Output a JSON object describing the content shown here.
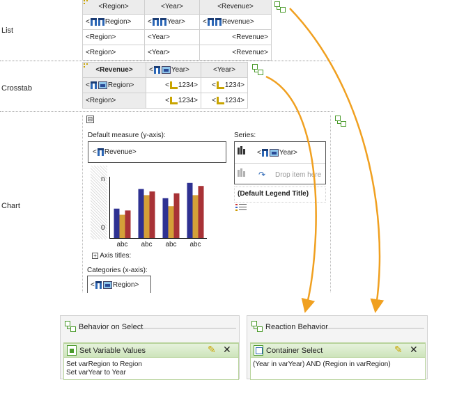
{
  "rows": {
    "list": "List",
    "crosstab": "Crosstab",
    "chart": "Chart"
  },
  "list": {
    "headers": [
      "<Region>",
      "<Year>",
      "<Revenue>"
    ],
    "field_row": {
      "region_pre": "<",
      "region": "Region>",
      "year_pre": "<",
      "year": "Year>",
      "revenue_pre": "<",
      "revenue": "Revenue>"
    },
    "rows": [
      [
        "<Region>",
        "<Year>",
        "<Revenue>"
      ],
      [
        "<Region>",
        "<Year>",
        "<Revenue>"
      ]
    ]
  },
  "crosstab": {
    "corner": "<Revenue>",
    "col_year_field_pre": "<",
    "col_year_field": "Year>",
    "col_year": "<Year>",
    "row1_pre": "<",
    "row1": "Region>",
    "row2": "<Region>",
    "cell_pre": "<",
    "cell": "1234>"
  },
  "chart": {
    "collapse_icon": "⊟",
    "default_measure_label": "Default measure (y-axis):",
    "measure_pre": "<",
    "measure": "Revenue>",
    "series_label": "Series:",
    "series_pre": "<",
    "series_field": "Year>",
    "drop_item": "Drop item here",
    "legend_title": "(Default Legend Title)",
    "y_top": "n",
    "y_bottom": "0",
    "axis_titles": "Axis titles:",
    "categories_label": "Categories (x-axis):",
    "categories_pre": "<",
    "categories_field": "Region>"
  },
  "chart_data": {
    "type": "bar",
    "categories": [
      "abc",
      "abc",
      "abc",
      "abc"
    ],
    "series": [
      {
        "values": [
          0.48,
          0.8,
          0.65,
          0.9
        ],
        "color": "#2e3192"
      },
      {
        "values": [
          0.38,
          0.7,
          0.52,
          0.7
        ],
        "color": "#d4a038"
      },
      {
        "values": [
          0.45,
          0.76,
          0.73,
          0.85
        ],
        "color": "#a83236"
      }
    ],
    "ylim": [
      0,
      1
    ]
  },
  "behavior_panel": {
    "title": "Behavior on Select",
    "item_title": "Set Variable Values",
    "lines": [
      "Set varRegion to Region",
      "Set varYear to Year"
    ]
  },
  "reaction_panel": {
    "title": "Reaction Behavior",
    "item_title": "Container Select",
    "lines": [
      "(Year in varYear) AND (Region in varRegion)"
    ]
  },
  "colors": {
    "arrow": "#f0a020",
    "green": "#4a9a2a",
    "header_bg": "#ececec"
  }
}
